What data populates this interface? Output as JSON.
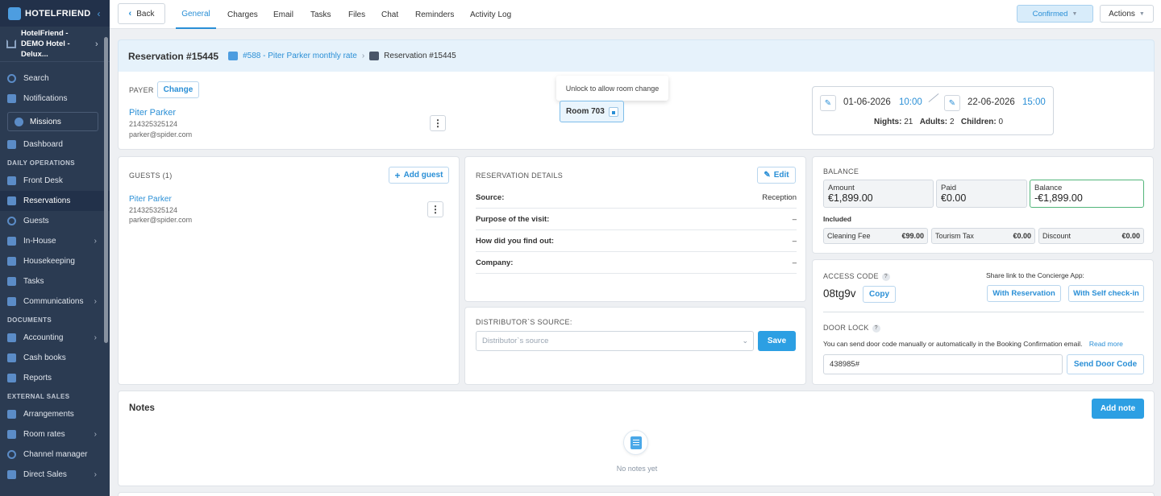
{
  "sidebar": {
    "brand": "HOTELFRIEND",
    "hotel": "HotelFriend - DEMO Hotel - Delux...",
    "search": "Search",
    "notifications": "Notifications",
    "missions": "Missions",
    "dashboard": "Dashboard",
    "sections": {
      "daily": "DAILY OPERATIONS",
      "documents": "DOCUMENTS",
      "external": "EXTERNAL SALES"
    },
    "daily_items": [
      "Front Desk",
      "Reservations",
      "Guests",
      "In-House",
      "Housekeeping",
      "Tasks",
      "Communications"
    ],
    "document_items": [
      "Accounting",
      "Cash books",
      "Reports"
    ],
    "external_items": [
      "Arrangements",
      "Room rates",
      "Channel manager",
      "Direct Sales"
    ]
  },
  "topbar": {
    "back": "Back",
    "tabs": [
      "General",
      "Charges",
      "Email",
      "Tasks",
      "Files",
      "Chat",
      "Reminders",
      "Activity Log"
    ],
    "status": "Confirmed",
    "actions": "Actions"
  },
  "reservation": {
    "title": "Reservation #15445",
    "rate_link": "#588 - Piter Parker monthly rate",
    "crumb_current": "Reservation #15445"
  },
  "payer": {
    "label": "PAYER",
    "change": "Change",
    "name": "Piter Parker",
    "phone": "214325325124",
    "email": "parker@spider.com"
  },
  "room": {
    "tooltip": "Unlock to allow room change",
    "label": "Room 703"
  },
  "stay": {
    "arrival_date": "01-06-2026",
    "arrival_time": "10:00",
    "departure_date": "22-06-2026",
    "departure_time": "15:00",
    "nights_label": "Nights:",
    "nights": "21",
    "adults_label": "Adults:",
    "adults": "2",
    "children_label": "Children:",
    "children": "0"
  },
  "guests": {
    "label": "GUESTS (1)",
    "add": "Add guest",
    "name": "Piter Parker",
    "phone": "214325325124",
    "email": "parker@spider.com"
  },
  "details": {
    "label": "RESERVATION DETAILS",
    "edit": "Edit",
    "rows": [
      {
        "k": "Source:",
        "v": "Reception"
      },
      {
        "k": "Purpose of the visit:",
        "v": "–"
      },
      {
        "k": "How did you find out:",
        "v": "–"
      },
      {
        "k": "Company:",
        "v": "–"
      }
    ]
  },
  "distributor": {
    "label": "DISTRIBUTOR`S SOURCE:",
    "placeholder": "Distributor`s source",
    "save": "Save"
  },
  "balance": {
    "label": "BALANCE",
    "amount_label": "Amount",
    "amount": "€1,899.00",
    "paid_label": "Paid",
    "paid": "€0.00",
    "balance_label": "Balance",
    "balance": "-€1,899.00",
    "included_label": "Included",
    "included": [
      {
        "k": "Cleaning Fee",
        "v": "€99.00"
      },
      {
        "k": "Tourism Tax",
        "v": "€0.00"
      },
      {
        "k": "Discount",
        "v": "€0.00"
      }
    ]
  },
  "access": {
    "label": "ACCESS CODE",
    "code": "08tg9v",
    "copy": "Copy",
    "share_text": "Share link to the Concierge App:",
    "with_reservation": "With Reservation",
    "with_self_checkin": "With Self check-in",
    "door_lock_label": "DOOR LOCK",
    "door_text": "You can send door code manually or automatically in the Booking Confirmation email.",
    "read_more": "Read more",
    "door_code": "438985#",
    "send": "Send Door Code"
  },
  "notes": {
    "title": "Notes",
    "add": "Add note",
    "empty": "No notes yet"
  },
  "colors": {
    "accent": "#2a8fd6",
    "sidebar_bg": "#2b3b52",
    "balance_border": "#52b57a",
    "primary_button": "#2c9fe3"
  }
}
